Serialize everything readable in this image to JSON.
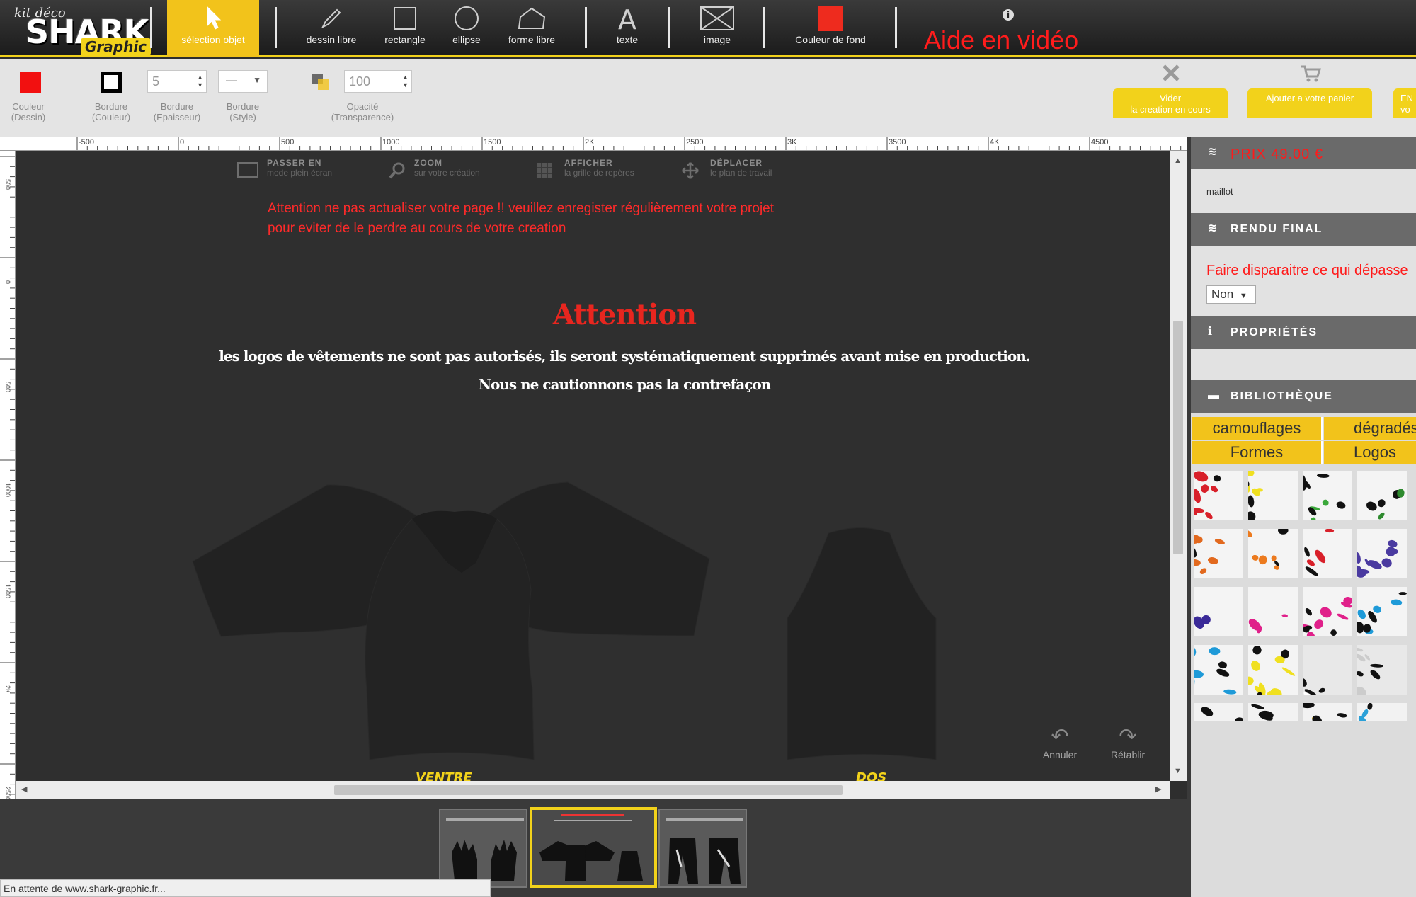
{
  "logo": {
    "kit": "kit déco",
    "brand": "SHARK",
    "sub": "Graphic"
  },
  "toolbar": {
    "tools": [
      {
        "label": "sélection objet",
        "icon": "cursor-icon"
      },
      {
        "label": "dessin libre",
        "icon": "pencil-icon"
      },
      {
        "label": "rectangle",
        "icon": "rectangle-icon"
      },
      {
        "label": "ellipse",
        "icon": "ellipse-icon"
      },
      {
        "label": "forme libre",
        "icon": "polygon-icon"
      },
      {
        "label": "texte",
        "icon": "text-icon"
      },
      {
        "label": "image",
        "icon": "image-icon"
      },
      {
        "label": "Couleur de fond",
        "icon": "fill-color-icon"
      }
    ],
    "help_video": "Aide en vidéo",
    "help_info": "i",
    "accent": "#f2c31b",
    "background_color": "#ee2b1e"
  },
  "props": {
    "color_label1": "Couleur",
    "color_label2": "(Dessin)",
    "color_value": "#f21010",
    "border_color_label1": "Bordure",
    "border_color_label2": "(Couleur)",
    "thickness_value": "5",
    "thickness_label1": "Bordure",
    "thickness_label2": "(Epaisseur)",
    "style_value": "—",
    "style_label1": "Bordure",
    "style_label2": "(Style)",
    "opacity_value": "100",
    "opacity_label1": "Opacité",
    "opacity_label2": "(Transparence)",
    "clear_btn1": "Vider",
    "clear_btn2": "la creation en cours",
    "cart_btn": "Ajouter a votre panier",
    "next_btn1": "EN",
    "next_btn2": "vo"
  },
  "ruler": {
    "h_ticks": [
      "-500",
      "0",
      "500",
      "1000",
      "1500",
      "2K",
      "2500",
      "3K",
      "3500",
      "4K",
      "4500"
    ],
    "v_ticks": [
      "500",
      "0",
      "500",
      "1000",
      "1500",
      "2K",
      "2500"
    ]
  },
  "canvas_tools": [
    {
      "title": "PASSER EN",
      "sub": "mode plein écran",
      "icon": "fullscreen-icon"
    },
    {
      "title": "ZOOM",
      "sub": "sur votre création",
      "icon": "zoom-icon"
    },
    {
      "title": "AFFICHER",
      "sub": "la grille de repères",
      "icon": "grid-icon"
    },
    {
      "title": "DÉPLACER",
      "sub": "le plan de travail",
      "icon": "move-icon"
    }
  ],
  "warning": {
    "line1": "Attention ne pas actualiser votre page !! veuillez enregister régulièrement votre projet",
    "line2": "pour eviter de le perdre au cours de votre creation"
  },
  "notice": {
    "title": "Attention",
    "line1": "les logos de vêtements ne sont pas autorisés, ils seront systématiquement supprimés avant mise en production.",
    "line2": "Nous ne cautionnons pas la contrefaçon"
  },
  "pieces": {
    "front_label": "VENTRE",
    "back_label": "DOS"
  },
  "history": {
    "undo": "Annuler",
    "redo": "Rétablir"
  },
  "status_bar": "En attente de www.shark-graphic.fr...",
  "sidebar": {
    "price": "PRIX 49.00 €",
    "product": "maillot",
    "final_render_title": "RENDU FINAL",
    "overflow_label": "Faire disparaitre ce qui dépasse",
    "overflow_value": "Non",
    "properties_title": "PROPRIÉTÉS",
    "library_title": "BIBLIOTHÈQUE",
    "library_tabs": [
      "camouflages",
      "dégradés",
      "Formes",
      "Logos"
    ],
    "swatch_colors": [
      [
        "#d8202a",
        "#f0e020",
        "#3aa83a",
        "#2e8a2e"
      ],
      [
        "#e2691e",
        "#ec7a1e",
        "#d8202a",
        "#4a3aa0"
      ],
      [
        "#3a2a98",
        "#e0208a",
        "#e0208a",
        "#1e9ad8"
      ],
      [
        "#1e9ad8",
        "#f0e020",
        "#ffffff",
        "#cccccc"
      ],
      [
        "#333333",
        "#d8202a",
        "#f0d020",
        "#2aa0d8"
      ]
    ]
  }
}
